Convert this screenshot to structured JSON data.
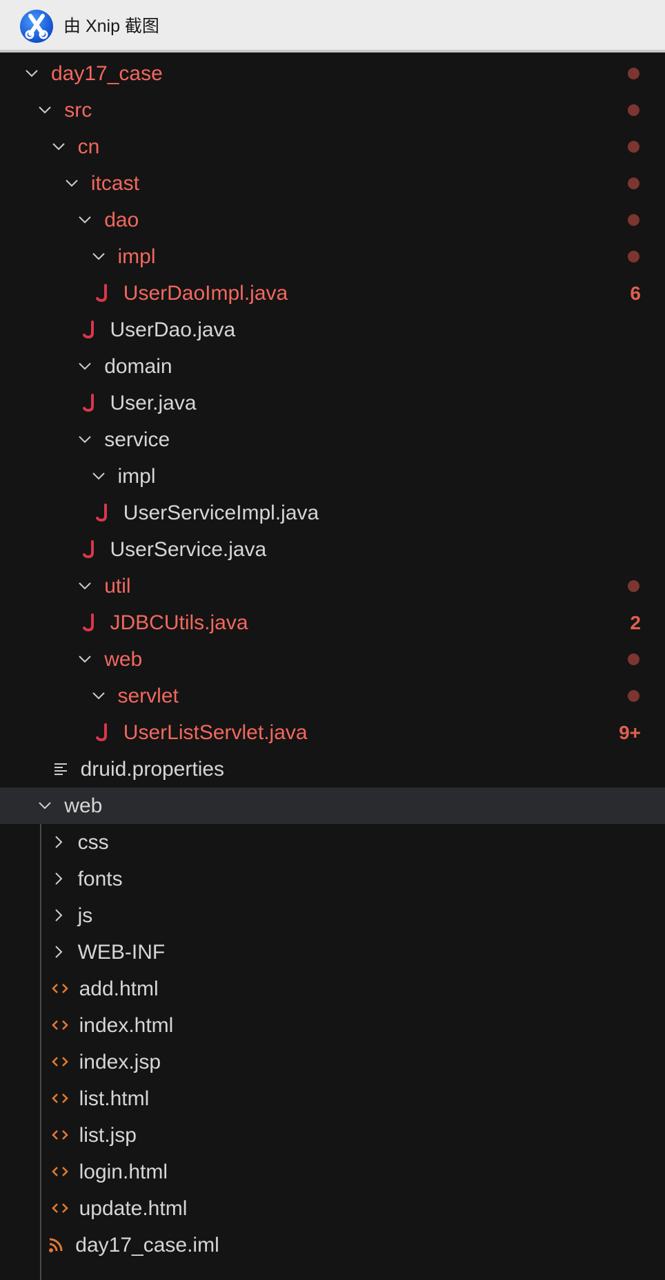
{
  "app": {
    "title": "由 Xnip 截图",
    "icon": "xnip-scissors-icon"
  },
  "colors": {
    "background": "#141414",
    "text": "#d6d6d6",
    "error_text": "#f2685e",
    "error_dot": "#7d3530",
    "java_icon": "#d9374b",
    "html_icon": "#e37933",
    "selected_row": "#2a2b2e"
  },
  "tree": {
    "rows": [
      {
        "label": "day17_case",
        "kind": "folder",
        "expanded": true,
        "error": true,
        "dot": true
      },
      {
        "label": "src",
        "kind": "folder",
        "expanded": true,
        "error": true,
        "dot": true
      },
      {
        "label": "cn",
        "kind": "folder",
        "expanded": true,
        "error": true,
        "dot": true
      },
      {
        "label": "itcast",
        "kind": "folder",
        "expanded": true,
        "error": true,
        "dot": true
      },
      {
        "label": "dao",
        "kind": "folder",
        "expanded": true,
        "error": true,
        "dot": true
      },
      {
        "label": "impl",
        "kind": "folder",
        "expanded": true,
        "error": true,
        "dot": true
      },
      {
        "label": "UserDaoImpl.java",
        "kind": "java",
        "error": true,
        "badge": "6"
      },
      {
        "label": "UserDao.java",
        "kind": "java"
      },
      {
        "label": "domain",
        "kind": "folder",
        "expanded": true
      },
      {
        "label": "User.java",
        "kind": "java"
      },
      {
        "label": "service",
        "kind": "folder",
        "expanded": true
      },
      {
        "label": "impl",
        "kind": "folder",
        "expanded": true
      },
      {
        "label": "UserServiceImpl.java",
        "kind": "java"
      },
      {
        "label": "UserService.java",
        "kind": "java"
      },
      {
        "label": "util",
        "kind": "folder",
        "expanded": true,
        "error": true,
        "dot": true
      },
      {
        "label": "JDBCUtils.java",
        "kind": "java",
        "error": true,
        "badge": "2"
      },
      {
        "label": "web",
        "kind": "folder",
        "expanded": true,
        "error": true,
        "dot": true
      },
      {
        "label": "servlet",
        "kind": "folder",
        "expanded": true,
        "error": true,
        "dot": true
      },
      {
        "label": "UserListServlet.java",
        "kind": "java",
        "error": true,
        "badge": "9+"
      },
      {
        "label": "druid.properties",
        "kind": "properties"
      },
      {
        "label": "web",
        "kind": "folder",
        "expanded": true,
        "selected": true
      },
      {
        "label": "css",
        "kind": "folder",
        "expanded": false
      },
      {
        "label": "fonts",
        "kind": "folder",
        "expanded": false
      },
      {
        "label": "js",
        "kind": "folder",
        "expanded": false
      },
      {
        "label": "WEB-INF",
        "kind": "folder",
        "expanded": false
      },
      {
        "label": "add.html",
        "kind": "html"
      },
      {
        "label": "index.html",
        "kind": "html"
      },
      {
        "label": "index.jsp",
        "kind": "html"
      },
      {
        "label": "list.html",
        "kind": "html"
      },
      {
        "label": "list.jsp",
        "kind": "html"
      },
      {
        "label": "login.html",
        "kind": "html"
      },
      {
        "label": "update.html",
        "kind": "html"
      },
      {
        "label": "day17_case.iml",
        "kind": "iml"
      }
    ]
  }
}
